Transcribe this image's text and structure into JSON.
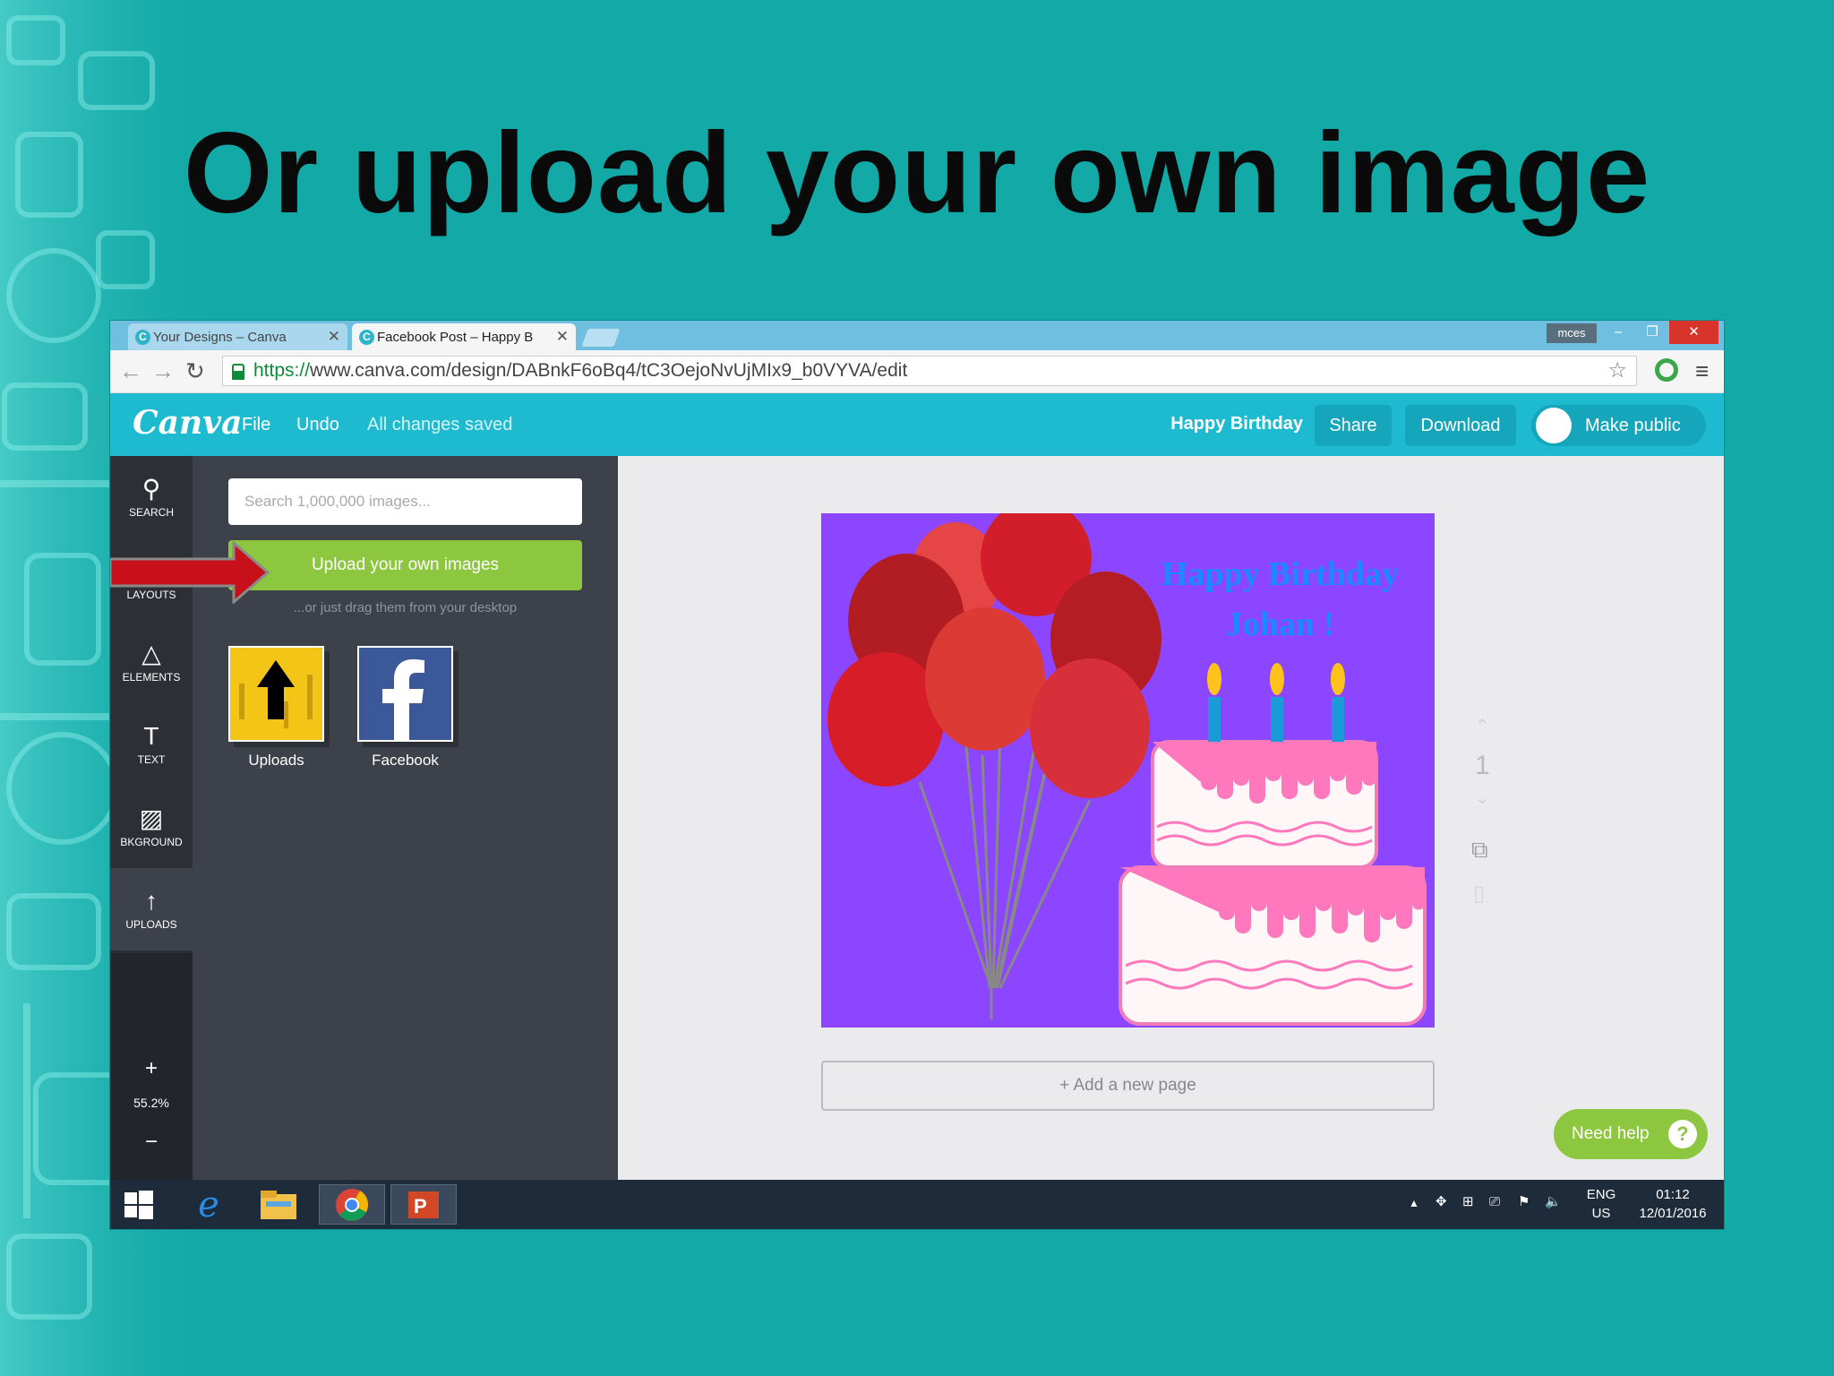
{
  "slide": {
    "title": "Or upload your own image"
  },
  "browser": {
    "tabs": [
      {
        "label": "Your Designs – Canva",
        "active": false
      },
      {
        "label": "Facebook Post – Happy B",
        "active": true
      }
    ],
    "user": "mces",
    "url_scheme": "https://",
    "url_rest": "www.canva.com/design/DABnkF6oBq4/tC3OejoNvUjMIx9_b0VYVA/edit"
  },
  "canva": {
    "logo": "Canva",
    "menu": {
      "file": "File",
      "undo": "Undo",
      "status": "All changes saved"
    },
    "design_name": "Happy Birthday",
    "share": "Share",
    "download": "Download",
    "make_public": "Make public"
  },
  "rail": {
    "items": [
      {
        "label": "SEARCH",
        "icon": "search-icon"
      },
      {
        "label": "LAYOUTS",
        "icon": "layouts-icon"
      },
      {
        "label": "ELEMENTS",
        "icon": "elements-icon"
      },
      {
        "label": "TEXT",
        "icon": "text-icon"
      },
      {
        "label": "BKGROUND",
        "icon": "background-icon"
      },
      {
        "label": "UPLOADS",
        "icon": "upload-icon"
      }
    ],
    "zoom": "55.2%",
    "zoom_in": "+",
    "zoom_out": "−"
  },
  "panel": {
    "search_placeholder": "Search 1,000,000 images...",
    "upload_button": "Upload your own images",
    "hint": "...or just drag them from your desktop",
    "folders": [
      {
        "label": "Uploads"
      },
      {
        "label": "Facebook"
      }
    ]
  },
  "canvas": {
    "greeting_line1": "Happy Birthday",
    "greeting_line2": "Johan !",
    "page_number": "1",
    "add_page": "+ Add a new page"
  },
  "help": {
    "label": "Need help",
    "icon": "?"
  },
  "taskbar": {
    "lang1": "ENG",
    "lang2": "US",
    "time": "01:12",
    "date": "12/01/2016"
  },
  "colors": {
    "canva_teal": "#1ebbd0",
    "upload_green": "#8dc63f",
    "canvas_purple": "#8c46ff",
    "slide_bg": "#12a9a7"
  }
}
